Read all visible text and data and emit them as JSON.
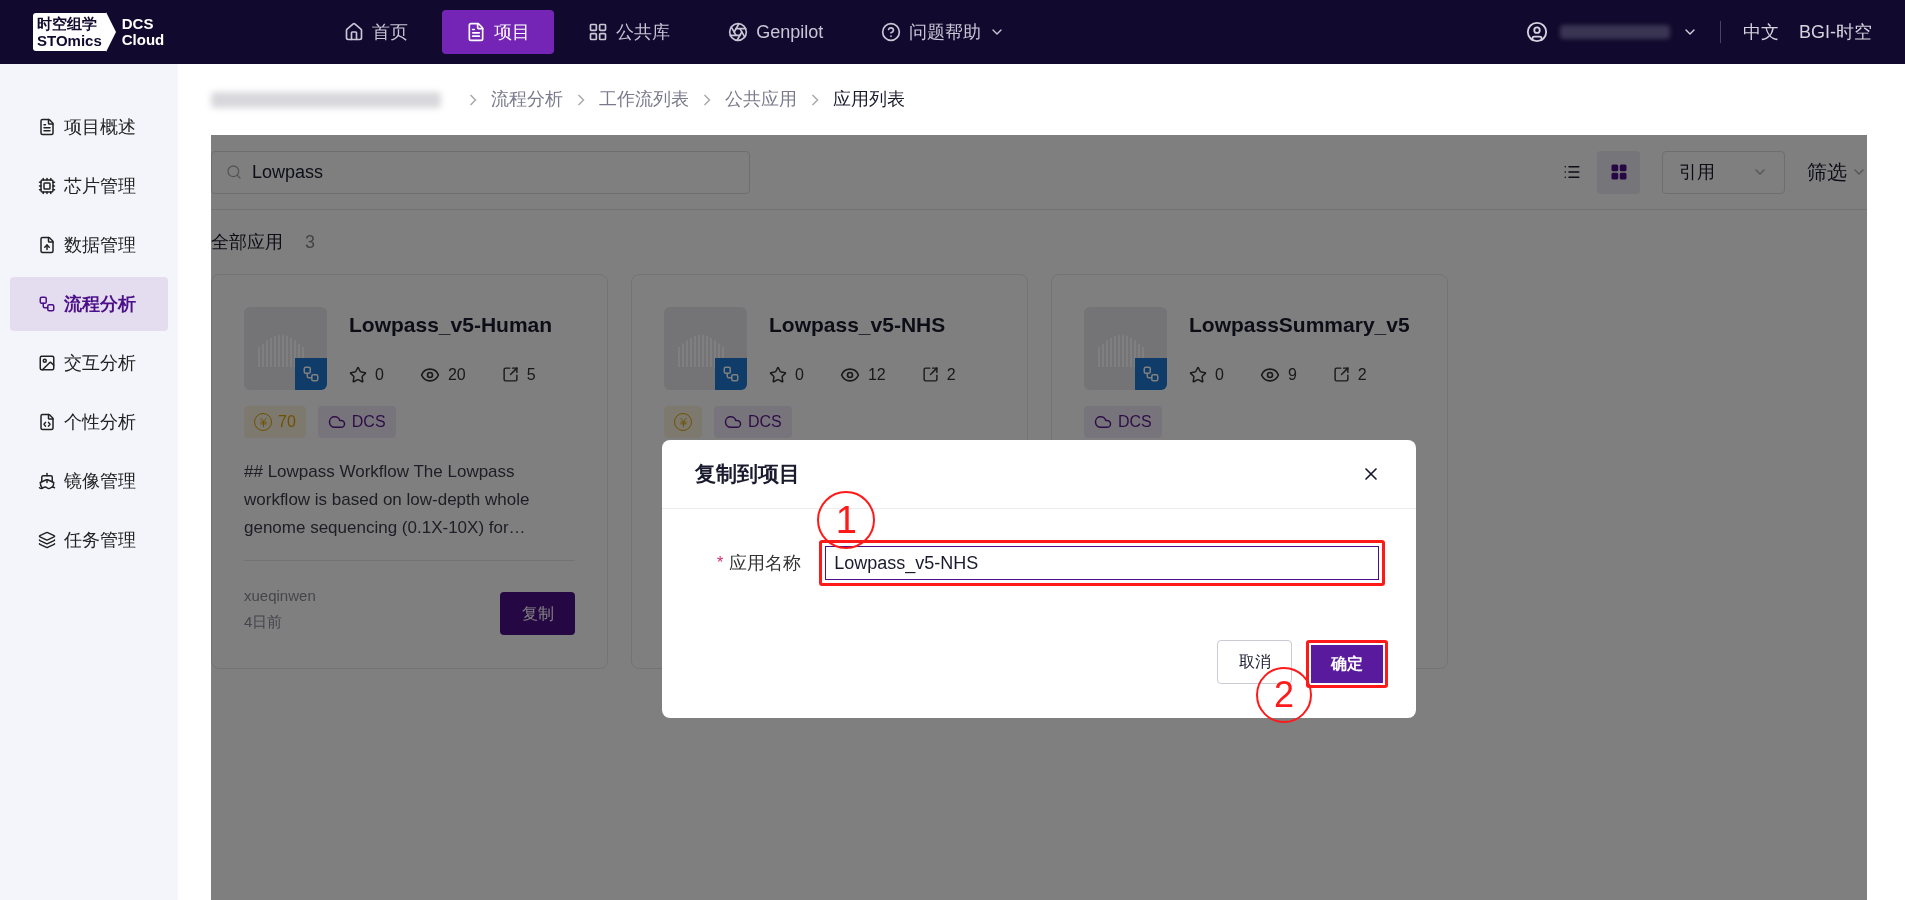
{
  "logo": {
    "top": "时空组学",
    "bottom": "STOmics",
    "product_top": "DCS",
    "product_bottom": "Cloud"
  },
  "nav": [
    {
      "label": "首页",
      "selected": false,
      "dropdown": false
    },
    {
      "label": "项目",
      "selected": true,
      "dropdown": false
    },
    {
      "label": "公共库",
      "selected": false,
      "dropdown": false
    },
    {
      "label": "Genpilot",
      "selected": false,
      "dropdown": false
    },
    {
      "label": "问题帮助",
      "selected": false,
      "dropdown": true
    }
  ],
  "header_right": {
    "language": "中文",
    "organization": "BGI-时空"
  },
  "sidebar": {
    "items": [
      {
        "label": "项目概述",
        "selected": false
      },
      {
        "label": "芯片管理",
        "selected": false
      },
      {
        "label": "数据管理",
        "selected": false
      },
      {
        "label": "流程分析",
        "selected": true
      },
      {
        "label": "交互分析",
        "selected": false
      },
      {
        "label": "个性分析",
        "selected": false
      },
      {
        "label": "镜像管理",
        "selected": false
      },
      {
        "label": "任务管理",
        "selected": false
      }
    ]
  },
  "breadcrumb": [
    "流程分析",
    "工作流列表",
    "公共应用",
    "应用列表"
  ],
  "toolbar": {
    "search_value": "Lowpass",
    "views": [
      {
        "kind": "list",
        "selected": false
      },
      {
        "kind": "grid",
        "selected": true
      }
    ],
    "sort": "引用",
    "filter": "筛选"
  },
  "section": {
    "title": "全部应用",
    "count": "3"
  },
  "cards": [
    {
      "title": "Lowpass_v5-Human",
      "stars": "0",
      "views": "20",
      "shares": "5",
      "price_tag": true,
      "price": "70",
      "tags": [
        "DCS"
      ],
      "description": "## Lowpass Workflow The Lowpass workflow is based on low-depth whole genome sequencing (0.1X-10X) for…",
      "author": "xueqinwen",
      "time": "4日前",
      "button": "复制"
    },
    {
      "title": "Lowpass_v5-NHS",
      "stars": "0",
      "views": "12",
      "shares": "2",
      "price_tag": true,
      "tags": [
        "DCS"
      ]
    },
    {
      "title": "LowpassSummary_v5",
      "stars": "0",
      "views": "9",
      "shares": "2",
      "price_tag": false,
      "tags": [
        "DCS"
      ]
    }
  ],
  "dialog": {
    "title": "复制到项目",
    "field_label": "应用名称",
    "required_mark": "*",
    "field_value": "Lowpass_v5-NHS",
    "buttons": [
      {
        "label": "取消",
        "kind": "secondary"
      },
      {
        "label": "确定",
        "kind": "primary"
      }
    ]
  },
  "annotations": [
    "1",
    "2"
  ]
}
